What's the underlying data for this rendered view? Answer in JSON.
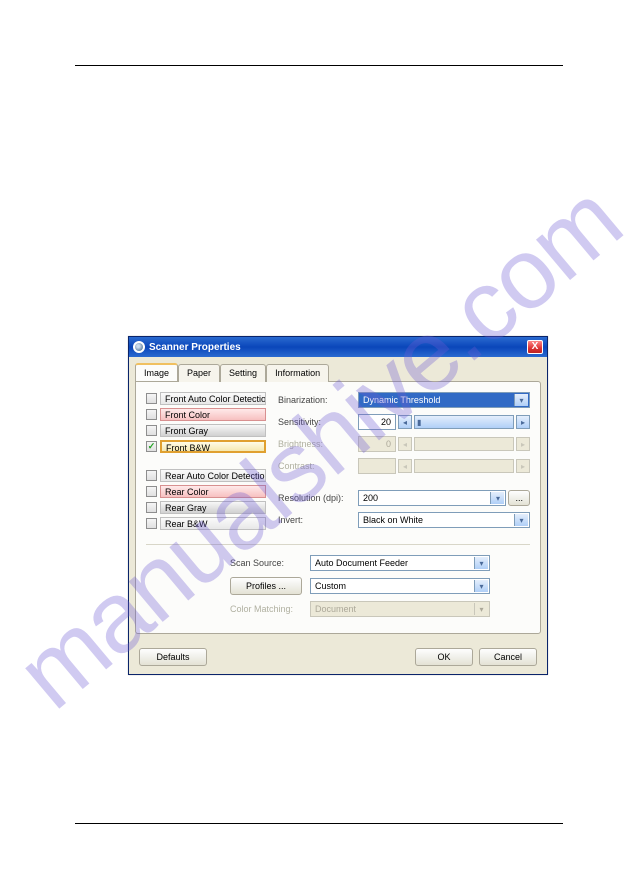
{
  "watermark": "manualshive.com",
  "window": {
    "title": "Scanner Properties",
    "close_glyph": "X",
    "tabs": [
      "Image",
      "Paper",
      "Setting",
      "Information"
    ],
    "active_tab": 0,
    "image_tab": {
      "front_checks": [
        {
          "label": "Front Auto Color Detection",
          "checked": false,
          "style": "plain"
        },
        {
          "label": "Front Color",
          "checked": false,
          "style": "color"
        },
        {
          "label": "Front Gray",
          "checked": false,
          "style": "gray"
        },
        {
          "label": "Front B&W",
          "checked": true,
          "style": "bw-sel"
        }
      ],
      "rear_checks": [
        {
          "label": "Rear Auto Color Detection",
          "checked": false,
          "style": "plain"
        },
        {
          "label": "Rear Color",
          "checked": false,
          "style": "color"
        },
        {
          "label": "Rear Gray",
          "checked": false,
          "style": "gray"
        },
        {
          "label": "Rear B&W",
          "checked": false,
          "style": "plain"
        }
      ],
      "labels": {
        "binarization": "Binarization:",
        "sensitivity": "Sensitivity:",
        "brightness": "Brightness:",
        "contrast": "Contrast:",
        "resolution": "Resolution (dpi):",
        "invert": "Invert:",
        "scan_source": "Scan Source:",
        "profiles_btn": "Profiles ...",
        "color_matching": "Color Matching:",
        "browse_btn": "..."
      },
      "values": {
        "binarization": "Dynamic Threshold",
        "sensitivity": "20",
        "brightness": "0",
        "contrast": "",
        "resolution": "200",
        "invert": "Black on White",
        "scan_source": "Auto Document Feeder",
        "profile": "Custom",
        "color_matching": "Document"
      }
    },
    "buttons": {
      "defaults": "Defaults",
      "ok": "OK",
      "cancel": "Cancel"
    }
  }
}
